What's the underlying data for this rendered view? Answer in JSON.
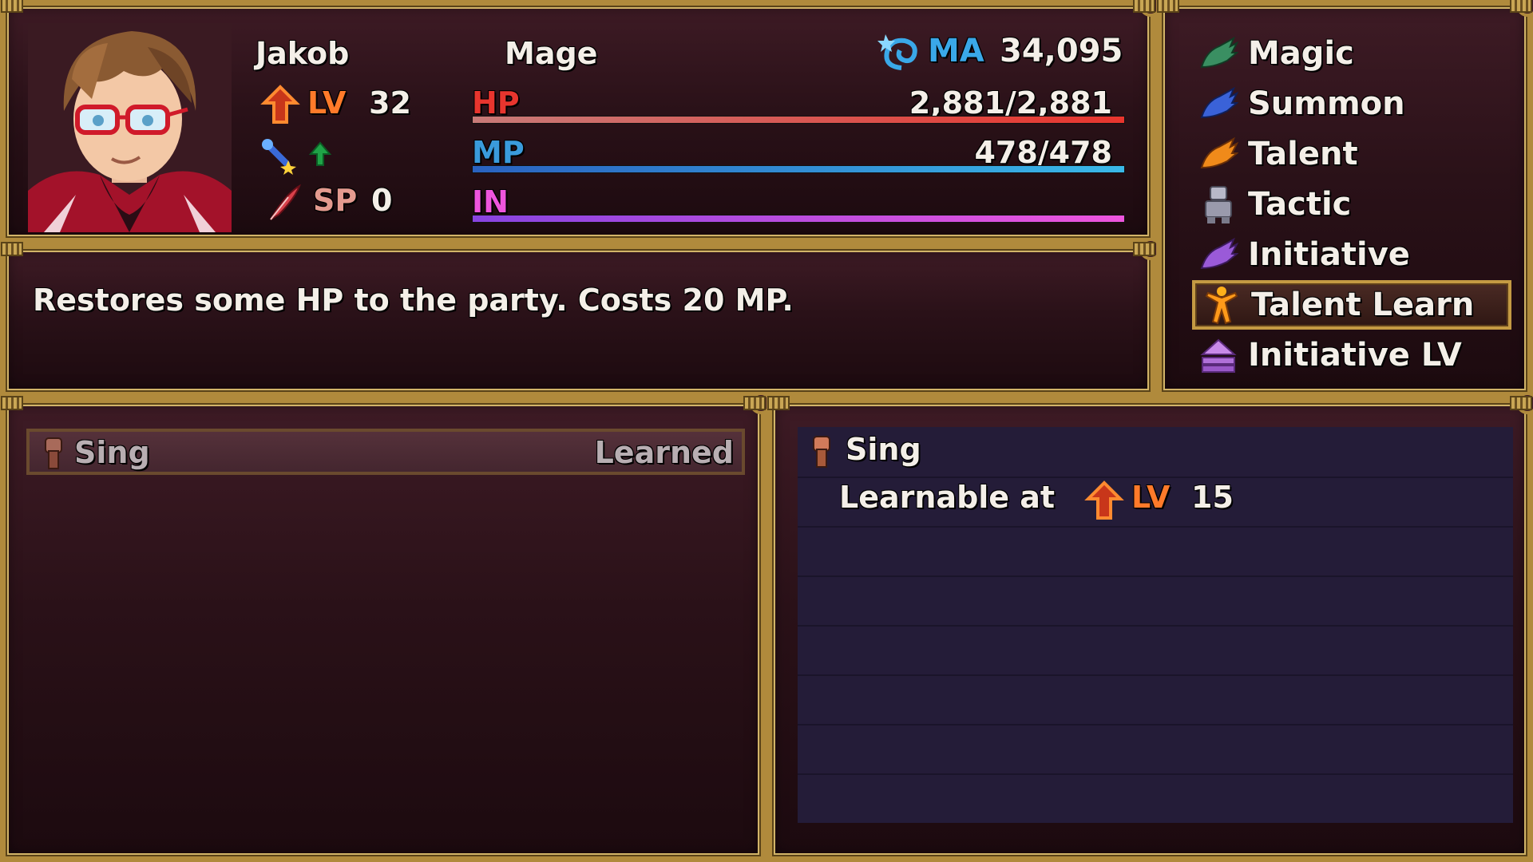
{
  "actor": {
    "name": "Jakob",
    "class": "Mage",
    "level_label": "LV",
    "level": "32",
    "sp_label": "SP",
    "sp": "0",
    "ma_label": "MA",
    "ma": "34,095",
    "hp_label": "HP",
    "hp": "2,881/2,881",
    "hp_ratio": 1.0,
    "mp_label": "MP",
    "mp": "478/478",
    "mp_ratio": 1.0,
    "in_label": "IN",
    "in_ratio": 1.0,
    "state_icons": [
      "wand-sparkle-icon",
      "green-leaf-icon"
    ]
  },
  "help": {
    "text": "Restores some HP to the party. Costs 20 MP."
  },
  "menu": {
    "items": [
      {
        "label": "Magic",
        "icon": "magic-claw-icon"
      },
      {
        "label": "Summon",
        "icon": "summon-claw-icon"
      },
      {
        "label": "Talent",
        "icon": "talent-claw-icon"
      },
      {
        "label": "Tactic",
        "icon": "tactic-robot-icon"
      },
      {
        "label": "Initiative",
        "icon": "initiative-claw-icon"
      },
      {
        "label": "Talent Learn",
        "icon": "talent-learn-figure-icon"
      },
      {
        "label": "Initiative LV",
        "icon": "initiative-lv-icon"
      }
    ],
    "selected_index": 5
  },
  "skill_list": {
    "items": [
      {
        "name": "Sing",
        "status": "Learned",
        "icon": "fist-icon"
      }
    ]
  },
  "skill_detail": {
    "name": "Sing",
    "requirement_text": "Learnable at",
    "level_label": "LV",
    "level": "15",
    "icon": "fist-icon"
  },
  "colors": {
    "hp": "#e8352e",
    "mp": "#3a9bdc",
    "in": "#cc55e8",
    "lv": "#ff7a2a",
    "sp": "#e49a8f",
    "ma": "#3aa8e8",
    "frame": "#b08a3c"
  }
}
